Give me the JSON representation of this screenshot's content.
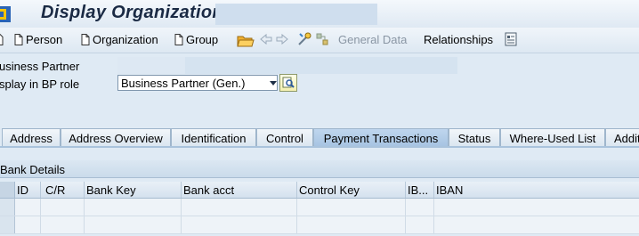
{
  "window": {
    "title": "Display Organization :"
  },
  "toolbar": {
    "person_label": "Person",
    "organization_label": "Organization",
    "group_label": "Group",
    "general_data_label": "General Data",
    "relationships_label": "Relationships"
  },
  "form": {
    "bp_label": "usiness Partner",
    "role_label": "splay in BP role",
    "role_value": "Business Partner (Gen.)"
  },
  "tabs": [
    {
      "label": "Address"
    },
    {
      "label": "Address Overview"
    },
    {
      "label": "Identification"
    },
    {
      "label": "Control"
    },
    {
      "label": "Payment Transactions",
      "active": true
    },
    {
      "label": "Status"
    },
    {
      "label": "Where-Used List"
    },
    {
      "label": "Addit"
    }
  ],
  "bank_details": {
    "header": "Bank Details",
    "columns": [
      "ID",
      "C/R",
      "Bank Key",
      "Bank acct",
      "Control Key",
      "IB...",
      "IBAN"
    ]
  },
  "colors": {
    "active_tab": "#a7c4e2",
    "background": "#dfeaf4"
  }
}
